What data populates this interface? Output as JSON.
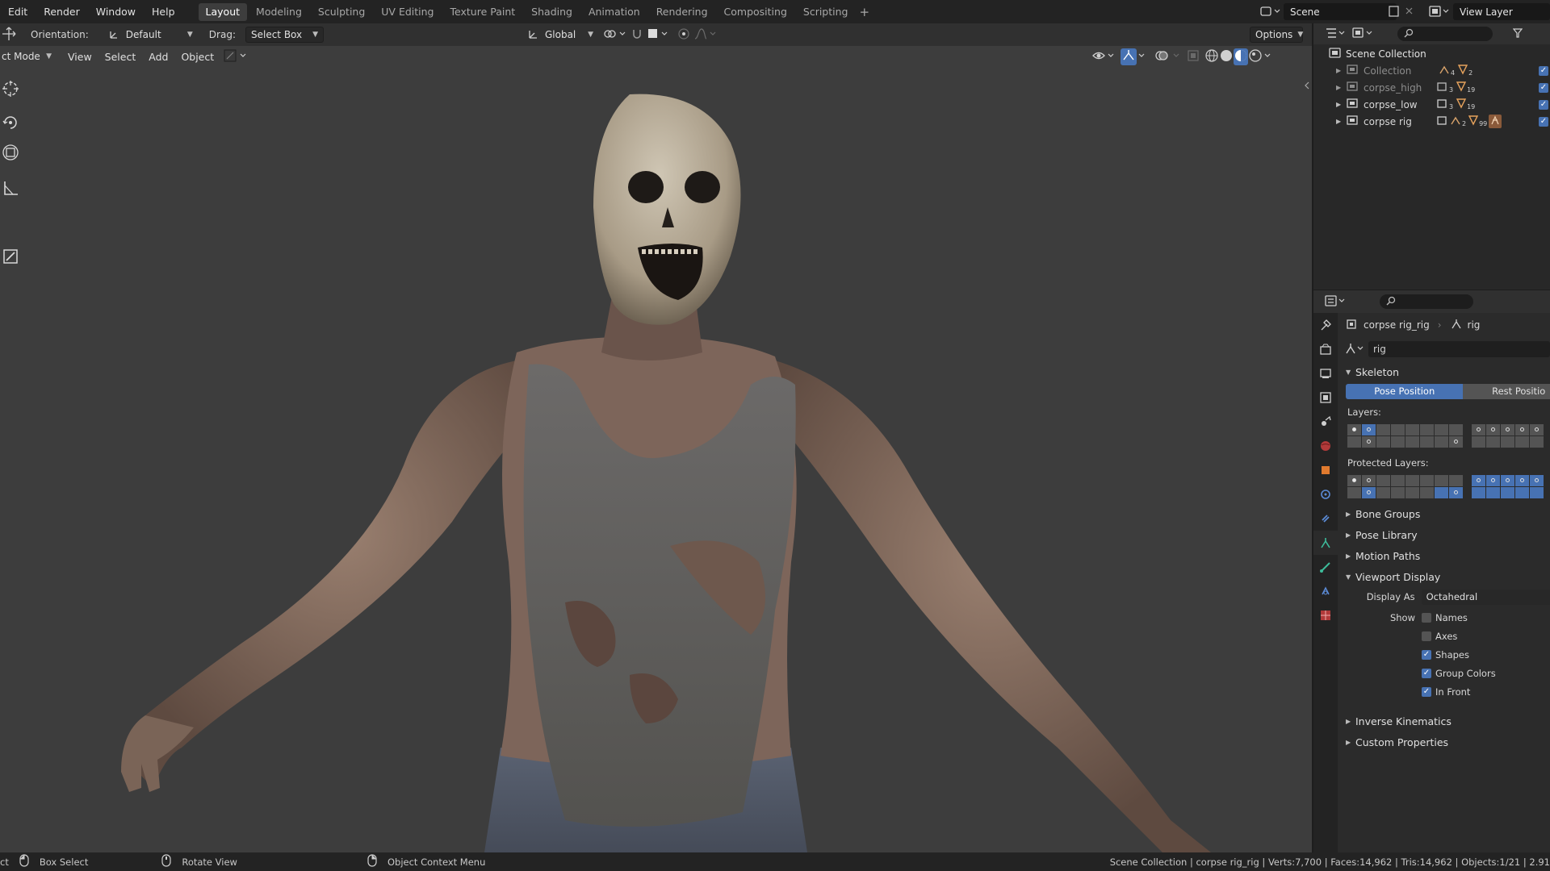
{
  "menu": [
    "Edit",
    "Render",
    "Window",
    "Help"
  ],
  "workspaces": [
    "Layout",
    "Modeling",
    "Sculpting",
    "UV Editing",
    "Texture Paint",
    "Shading",
    "Animation",
    "Rendering",
    "Compositing",
    "Scripting"
  ],
  "active_workspace": "Layout",
  "scene": {
    "label": "Scene"
  },
  "view_layer": {
    "label": "View Layer"
  },
  "tool_header": {
    "orientation_label": "Orientation:",
    "orientation_value": "Default",
    "drag_label": "Drag:",
    "drag_value": "Select Box",
    "transform_value": "Global",
    "options_label": "Options"
  },
  "viewport_header": {
    "mode": "ct Mode",
    "menus": [
      "View",
      "Select",
      "Add",
      "Object"
    ]
  },
  "outliner": {
    "root": "Scene Collection",
    "items": [
      {
        "name": "Collection",
        "dim": true,
        "badge1": "4",
        "badge2": "2"
      },
      {
        "name": "corpse_high",
        "dim": true,
        "badge1": "3",
        "badge2": "19"
      },
      {
        "name": "corpse_low",
        "dim": false,
        "badge1": "3",
        "badge2": "19"
      },
      {
        "name": "corpse rig",
        "dim": false,
        "badge1": "2",
        "badge2": "99"
      }
    ]
  },
  "properties": {
    "breadcrumb_object": "corpse rig_rig",
    "breadcrumb_data": "rig",
    "data_name": "rig",
    "skeleton": {
      "title": "Skeleton",
      "pose_position": "Pose Position",
      "rest_position": "Rest Positio",
      "layers_label": "Layers:",
      "protected_layers_label": "Protected Layers:"
    },
    "collapsed_panels_top": [
      "Bone Groups",
      "Pose Library",
      "Motion Paths"
    ],
    "viewport_display": {
      "title": "Viewport Display",
      "display_as_label": "Display As",
      "display_as_value": "Octahedral",
      "show_label": "Show",
      "options": [
        {
          "label": "Names",
          "checked": false
        },
        {
          "label": "Axes",
          "checked": false
        },
        {
          "label": "Shapes",
          "checked": true
        },
        {
          "label": "Group Colors",
          "checked": true
        },
        {
          "label": "In Front",
          "checked": true
        }
      ]
    },
    "collapsed_panels_bottom": [
      "Inverse Kinematics",
      "Custom Properties"
    ]
  },
  "statusbar": {
    "left_cut": "ct",
    "box_select": "Box Select",
    "rotate_view": "Rotate View",
    "context_menu": "Object Context Menu",
    "stats": "Scene Collection | corpse rig_rig | Verts:7,700 | Faces:14,962 | Tris:14,962 | Objects:1/21 | 2.91"
  },
  "colors": {
    "accent": "#4772b3",
    "viewport_bg": "#3d3d3d",
    "panel_bg": "#2b2b2b"
  }
}
